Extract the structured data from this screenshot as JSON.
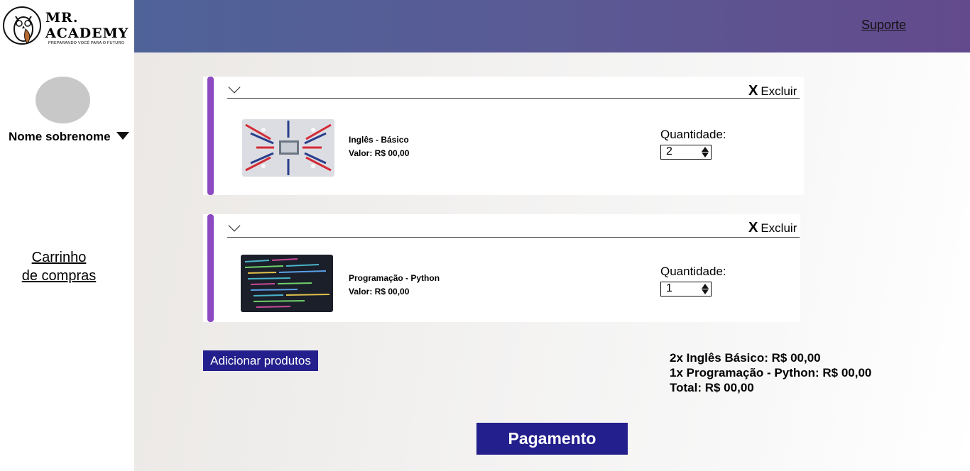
{
  "brand": {
    "line1": "MR.",
    "line2": "ACADEMY",
    "tagline": "PREPARANDO VOCÊ PARA O FUTURO"
  },
  "header": {
    "support_label": "Suporte"
  },
  "user": {
    "name": "Nome sobrenome"
  },
  "sidebar": {
    "cart_line1": "Carrinho",
    "cart_line2": "de compras"
  },
  "cart": {
    "remove_label": "Excluir",
    "remove_glyph": "X",
    "quantity_label": "Quantidade:",
    "items": [
      {
        "name": "Inglês - Básico",
        "price": "Valor: R$ 00,00",
        "quantity": "2",
        "image": "english-flags-image"
      },
      {
        "name": "Programação - Python",
        "price": "Valor: R$ 00,00",
        "quantity": "1",
        "image": "code-screen-image"
      }
    ]
  },
  "actions": {
    "add_products": "Adicionar produtos",
    "payment": "Pagamento"
  },
  "summary": {
    "line1": "2x Inglês Básico: R$ 00,00",
    "line2": "1x Programação - Python: R$ 00,00",
    "total": "Total: R$ 00,00"
  },
  "colors": {
    "accent": "#8d49c2",
    "button": "#231f8c",
    "header_start": "#4f6399",
    "header_end": "#634a8c"
  }
}
